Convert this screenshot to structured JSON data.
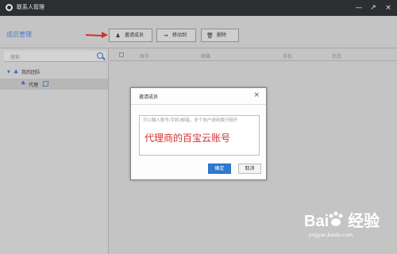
{
  "window": {
    "title": "联系人管理",
    "controls": [
      "minimize",
      "maximize",
      "close"
    ]
  },
  "page": {
    "heading": "成员管理"
  },
  "toolbar": {
    "invite_label": "邀请成员",
    "move_label": "移动到",
    "delete_label": "删除"
  },
  "sidebar": {
    "search_placeholder": "搜索",
    "team_label": "我的团队",
    "agent_label": "代理"
  },
  "table": {
    "headers": [
      "账号",
      "邮箱",
      "手机",
      "状态"
    ]
  },
  "dialog": {
    "title": "邀请成员",
    "placeholder": "可以输入账号/手机/邮箱，多个用户请用换行隔开",
    "entered_text": "代理商的百宝云账号",
    "ok_label": "确定",
    "cancel_label": "取消"
  },
  "watermark": {
    "brand": "Bai",
    "brand_suffix": "经验",
    "url": "jingyan.baidu.com"
  },
  "colors": {
    "accent": "#4a7cc2",
    "primary_button": "#2f78d1",
    "annotation_red": "#d3302f"
  }
}
